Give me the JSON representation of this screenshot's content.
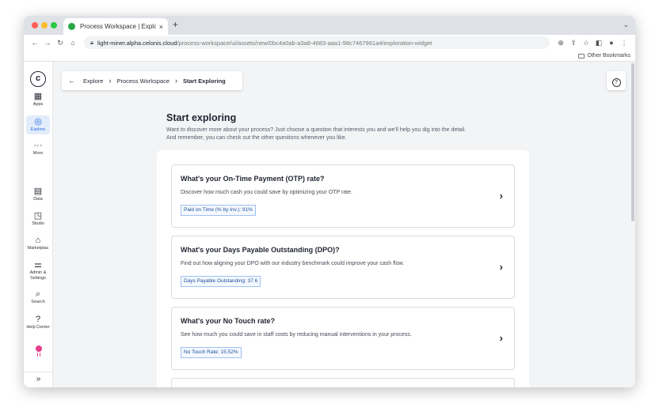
{
  "browser": {
    "tab_title": "Process Workspace | Explore",
    "tab_close": "×",
    "new_tab": "+",
    "tab_menu": "⌄",
    "url_host": "light-miner.alpha.celonis.cloud",
    "url_path": "/process-workspace/ui/assets/new/0bc4a0ab-a3a8-4683-aaa1-98c7467961a4/exploration-widget",
    "bookmarks_label": "Other Bookmarks",
    "window_buttons": {
      "close": "#ff5f57",
      "minimize": "#febc2e",
      "maximize": "#28c840"
    }
  },
  "sidebar": {
    "logo": "c",
    "items": [
      {
        "label": "Apps",
        "icon": "grid-icon",
        "glyph": "▦",
        "active": false
      },
      {
        "label": "Explore",
        "icon": "compass-icon",
        "glyph": "◎",
        "active": true
      },
      {
        "label": "More",
        "icon": "more-icon",
        "glyph": "···",
        "active": false
      },
      {
        "label": "Data",
        "icon": "database-icon",
        "glyph": "▤",
        "active": false
      },
      {
        "label": "Studio",
        "icon": "studio-icon",
        "glyph": "◳",
        "active": false
      },
      {
        "label": "Marketplac",
        "icon": "store-icon",
        "glyph": "⌂",
        "active": false
      },
      {
        "label": "Admin & Settings",
        "icon": "sliders-icon",
        "glyph": "⚌",
        "active": false
      },
      {
        "label": "Search",
        "icon": "search-icon",
        "glyph": "⌕",
        "active": false
      },
      {
        "label": "Help Center",
        "icon": "help-icon",
        "glyph": "?",
        "active": false
      }
    ],
    "collapse_glyph": "»"
  },
  "breadcrumb": {
    "back_glyph": "←",
    "items": [
      "Explore",
      "Process Workspace",
      "Start Exploring"
    ],
    "separator": "›"
  },
  "help_glyph": "?",
  "main": {
    "title": "Start exploring",
    "intro_line1": "Want to discover more about your process? Just choose a question that interests you and we'll help you dig into the detail.",
    "intro_line2": "And remember, you can check out the other questions whenever you like.",
    "cards": [
      {
        "title": "What's your On-Time Payment (OTP) rate?",
        "description": "Discover how much cash you could save by optimizing your OTP rate.",
        "badge": "Paid on Time (% by Inv.): 91%"
      },
      {
        "title": "What's your Days Payable Outstanding (DPO)?",
        "description": "Find out how aligning your DPO with our industry benchmark could improve your cash flow.",
        "badge": "Days Payable Outstanding: 37.6"
      },
      {
        "title": "What's your No Touch rate?",
        "description": "See how much you could save in staff costs by reducing manual interventions in your process.",
        "badge": "No Touch Rate: 15.52%"
      }
    ],
    "chevron": "›"
  }
}
